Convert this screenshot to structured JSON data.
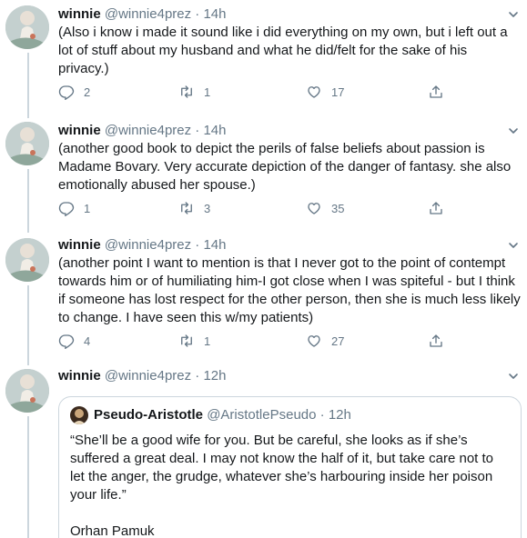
{
  "tweets": [
    {
      "name": "winnie",
      "handle": "@winnie4prez",
      "dot": "·",
      "time": "14h",
      "text": "(Also i know i made it sound like i did everything on my own, but i left out a lot of stuff about my husband and what he did/felt for the sake of his privacy.)",
      "replies": "2",
      "retweets": "1",
      "likes": "17"
    },
    {
      "name": "winnie",
      "handle": "@winnie4prez",
      "dot": "·",
      "time": "14h",
      "text": "(another good book to depict the perils of false beliefs about passion is Madame Bovary. Very accurate depiction of the danger of fantasy. she also emotionally abused her spouse.)",
      "replies": "1",
      "retweets": "3",
      "likes": "35"
    },
    {
      "name": "winnie",
      "handle": "@winnie4prez",
      "dot": "·",
      "time": "14h",
      "text": "(another point I want to mention is that I never got to the point of contempt towards him or of humiliating him-I got close when I was spiteful - but I think if someone has lost respect for the other person, then she is much less likely to change. I have seen this w/my patients)",
      "replies": "4",
      "retweets": "1",
      "likes": "27"
    },
    {
      "name": "winnie",
      "handle": "@winnie4prez",
      "dot": "·",
      "time": "12h"
    }
  ],
  "quote": {
    "name": "Pseudo-Aristotle",
    "handle": "@AristotlePseudo",
    "dot": "·",
    "time": "12h",
    "text": "“She’ll be a good wife for you. But be careful, she looks as if she’s suffered a great deal. I may not know the half of it, but take care not to let the anger, the grudge, whatever she’s harbouring inside her poison your life.”",
    "author": "Orhan Pamuk"
  },
  "icons": {
    "reply": "reply-icon",
    "retweet": "retweet-icon",
    "like": "heart-icon",
    "share": "share-icon",
    "more": "chevron-down-icon"
  },
  "colors": {
    "text": "#14171a",
    "secondary": "#657786",
    "line": "#ccd6dd"
  }
}
